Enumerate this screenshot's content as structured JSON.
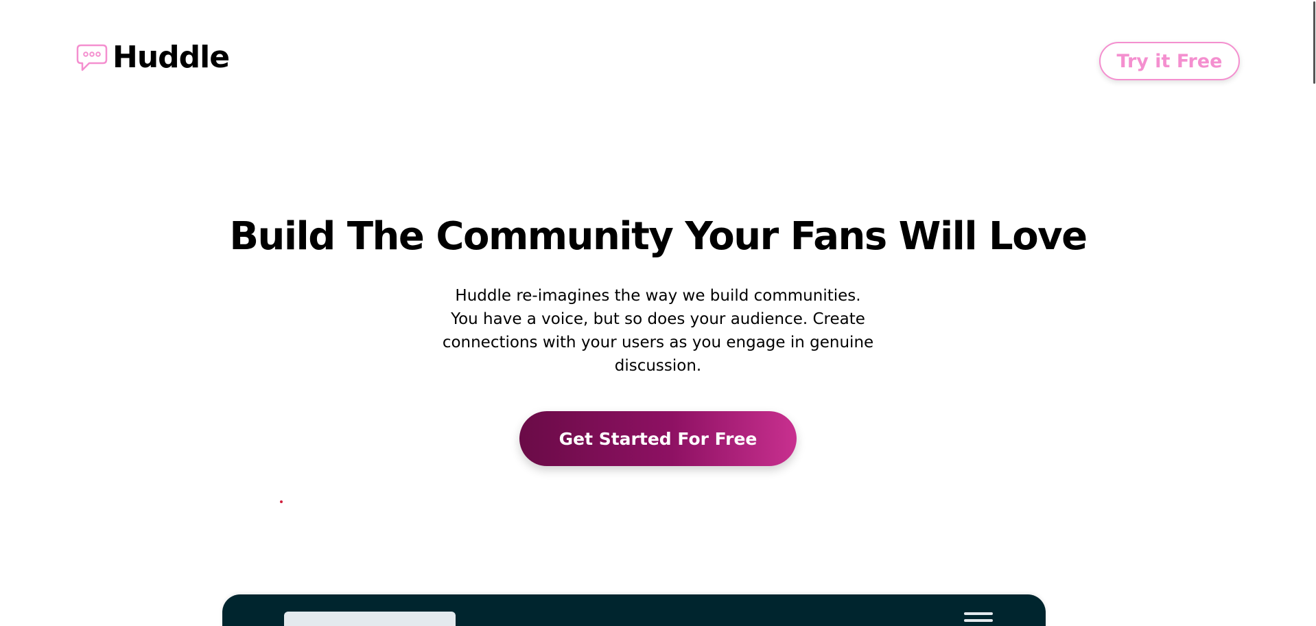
{
  "header": {
    "logo_text": "Huddle",
    "logo_icon": "chat-bubble-icon",
    "cta_label": "Try it Free"
  },
  "hero": {
    "title": "Build The Community Your Fans Will Love",
    "description": "Huddle re-imagines the way we build communities. You have a voice, but so does your audience. Create connections with your users as you engage in genuine discussion.",
    "cta_label": "Get Started For Free"
  },
  "mockup": {
    "menu_icon": "hamburger-menu-icon"
  },
  "colors": {
    "brand_pink": "#f48fcf",
    "brand_magenta_dark": "#6a0b47",
    "brand_magenta_light": "#c8308f",
    "mockup_background": "#00252e",
    "mockup_ui_light": "#e4eaee"
  }
}
